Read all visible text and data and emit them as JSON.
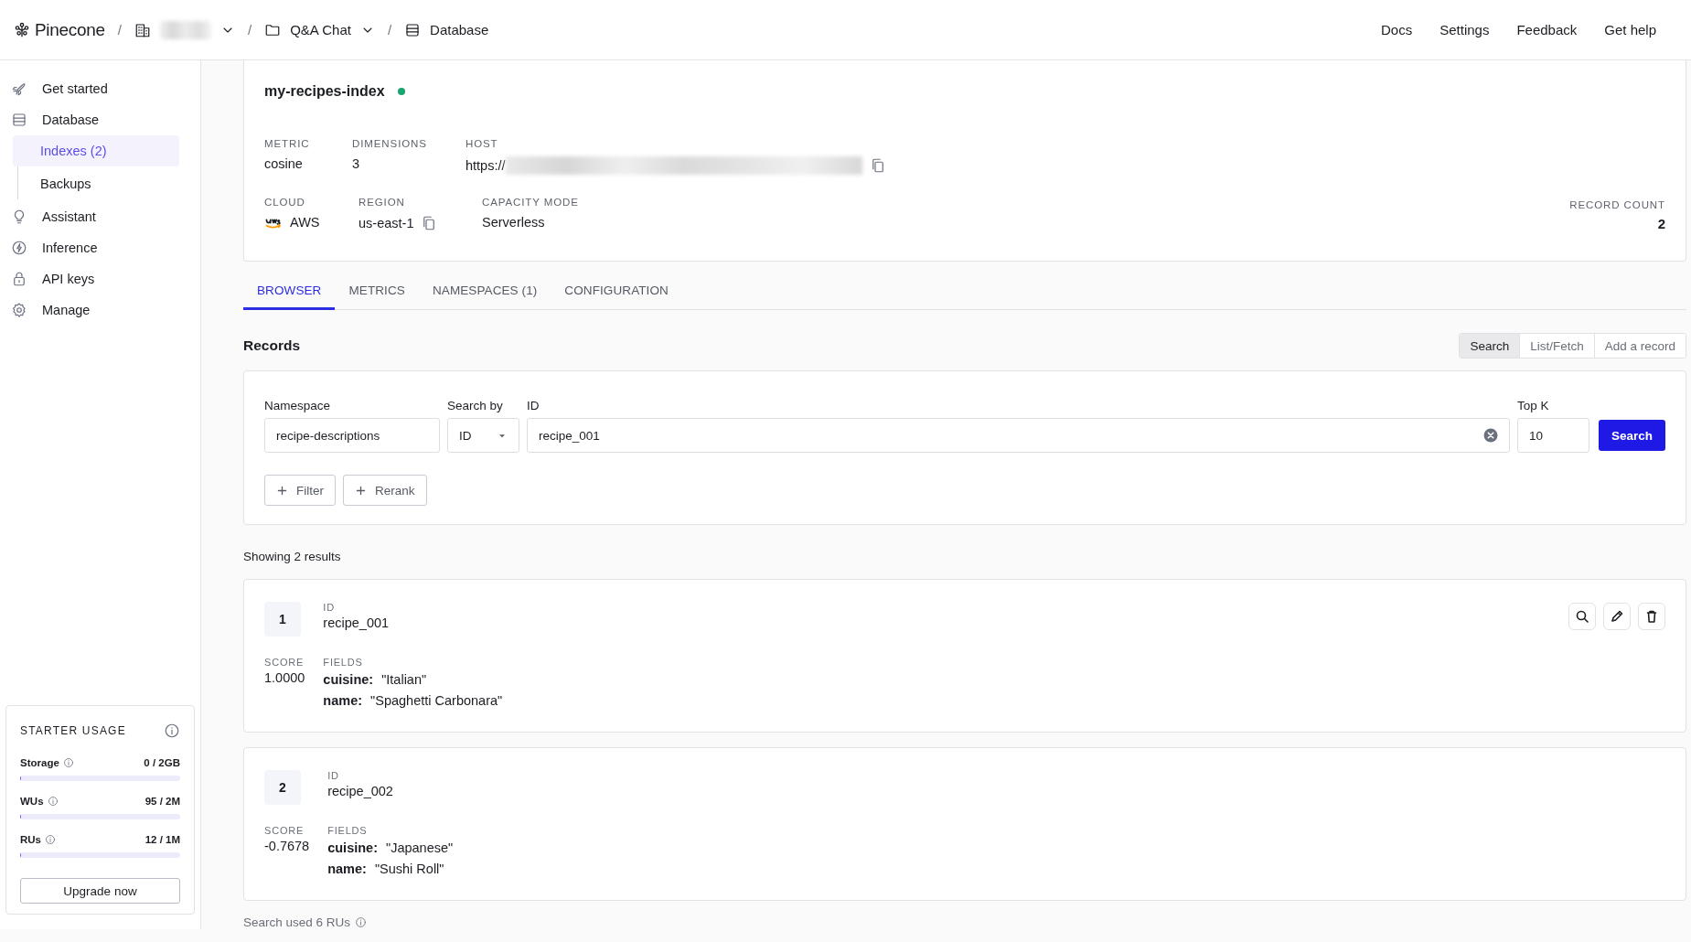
{
  "topbar": {
    "brand": "Pinecone",
    "breadcrumbs": [
      {
        "kind": "organization",
        "separator": "/",
        "dropdown": true
      },
      {
        "kind": "project",
        "separator": "/",
        "label": "Q&A Chat",
        "dropdown": true
      },
      {
        "kind": "database",
        "separator": "/",
        "label": "Database",
        "dropdown": false
      }
    ],
    "links": [
      "Docs",
      "Settings",
      "Feedback",
      "Get help"
    ]
  },
  "sidebar": {
    "items": [
      {
        "kind": "rocket",
        "label": "Get started",
        "selected": false
      },
      {
        "kind": "database",
        "label": "Database",
        "selected": false,
        "children": [
          {
            "label": "Indexes (2)",
            "selected": true
          },
          {
            "label": "Backups",
            "selected": false
          }
        ]
      },
      {
        "kind": "bulb",
        "label": "Assistant",
        "selected": false
      },
      {
        "kind": "bolt",
        "label": "Inference",
        "selected": false
      },
      {
        "kind": "lock",
        "label": "API keys",
        "selected": false
      },
      {
        "kind": "gear",
        "label": "Manage",
        "selected": false
      }
    ],
    "usage": {
      "title": "STARTER USAGE",
      "meters": [
        {
          "label": "Storage",
          "reading": "0 / 2GB",
          "level": 0.004
        },
        {
          "label": "WUs",
          "reading": "95 / 2M",
          "level": 0.004
        },
        {
          "label": "RUs",
          "reading": "12 / 1M",
          "level": 0.004
        }
      ],
      "button": "Upgrade now"
    }
  },
  "index": {
    "name": "my-recipes-index",
    "ready": true,
    "rows": [
      [
        {
          "label": "METRIC",
          "value": "cosine"
        },
        {
          "label": "DIMENSIONS",
          "value": "3"
        },
        {
          "label": "HOST",
          "value": "https://",
          "kind": "redacted",
          "copy": true
        }
      ],
      [
        {
          "label": "CLOUD",
          "value": "AWS",
          "kind": "aws"
        },
        {
          "label": "REGION",
          "value": "us-east-1",
          "copy": true
        },
        {
          "label": "CAPACITY MODE",
          "value": "Serverless"
        }
      ]
    ],
    "record_count": {
      "label": "RECORD COUNT",
      "value": "2"
    }
  },
  "tabs": [
    {
      "label": "BROWSER",
      "selected": true
    },
    {
      "label": "METRICS",
      "selected": false
    },
    {
      "label": "NAMESPACES (1)",
      "selected": false
    },
    {
      "label": "CONFIGURATION",
      "selected": false
    }
  ],
  "records": {
    "title": "Records",
    "modes": [
      {
        "label": "Search",
        "selected": true
      },
      {
        "label": "List/Fetch",
        "selected": false
      },
      {
        "label": "Add a record",
        "selected": false
      }
    ],
    "form": {
      "namespace": {
        "label": "Namespace",
        "value": "recipe-descriptions"
      },
      "search_by": {
        "label": "Search by",
        "value": "ID"
      },
      "id": {
        "label": "ID",
        "value": "recipe_001"
      },
      "top_k": {
        "label": "Top K",
        "value": "10"
      },
      "search_button": "Search",
      "options": [
        "Filter",
        "Rerank"
      ]
    },
    "summary": "Showing 2 results",
    "results": [
      {
        "rank": "1",
        "id_label": "ID",
        "id": "recipe_001",
        "score_label": "SCORE",
        "score": "1.0000",
        "fields_label": "FIELDS",
        "fields": [
          {
            "key": "cuisine:",
            "value": "\"Italian\""
          },
          {
            "key": "name:",
            "value": "\"Spaghetti Carbonara\""
          }
        ],
        "actions": true
      },
      {
        "rank": "2",
        "id_label": "ID",
        "id": "recipe_002",
        "score_label": "SCORE",
        "score": "-0.7678",
        "fields_label": "FIELDS",
        "fields": [
          {
            "key": "cuisine:",
            "value": "\"Japanese\""
          },
          {
            "key": "name:",
            "value": "\"Sushi Roll\""
          }
        ],
        "actions": false
      }
    ],
    "footer": "Search used 6 RUs"
  }
}
